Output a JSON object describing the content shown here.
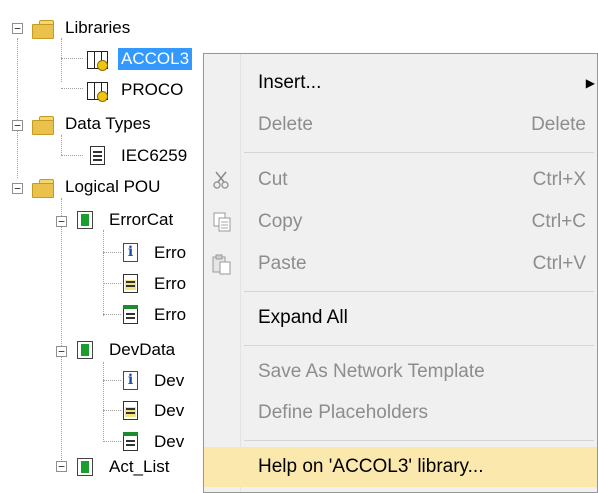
{
  "tree": {
    "libraries": "Libraries",
    "lib_accol3": "ACCOL3",
    "lib_proco": "PROCO",
    "data_types": "Data Types",
    "iec": "IEC6259",
    "logical_pou": "Logical POU",
    "errorcat": "ErrorCat",
    "err1": "Erro",
    "err2": "Erro",
    "err3": "Erro",
    "devdata": "DevData",
    "dev1": "Dev",
    "dev2": "Dev",
    "dev3": "Dev",
    "actlist": "Act_List"
  },
  "menu": {
    "insert": "Insert...",
    "delete": "Delete",
    "delete_shortcut": "Delete",
    "cut": "Cut",
    "cut_shortcut": "Ctrl+X",
    "copy": "Copy",
    "copy_shortcut": "Ctrl+C",
    "paste": "Paste",
    "paste_shortcut": "Ctrl+V",
    "expand_all": "Expand All",
    "save_template": "Save As Network Template",
    "define_placeholders": "Define Placeholders",
    "help_library": "Help on 'ACCOL3' library..."
  },
  "colors": {
    "selection": "#3399ff",
    "menu_highlight": "#fbe8ad",
    "disabled_text": "#8d8d8d"
  }
}
